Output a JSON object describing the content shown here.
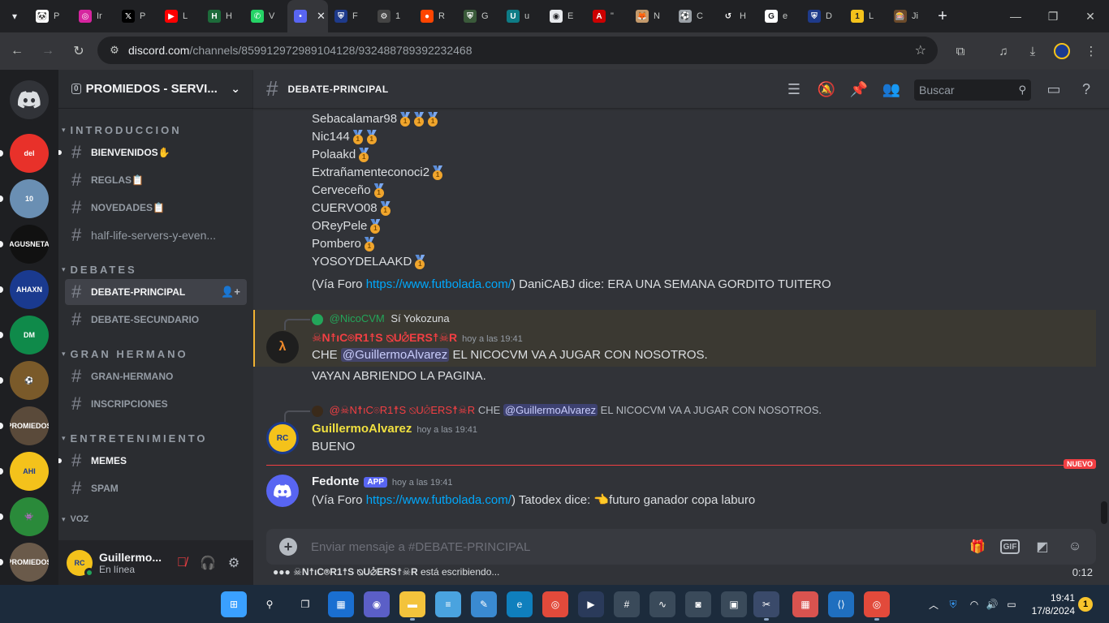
{
  "browser": {
    "tabs": [
      {
        "title": "P",
        "color": "#ffffff",
        "text": "🐼"
      },
      {
        "title": "Ir",
        "color": "#d6249f",
        "text": "◎"
      },
      {
        "title": "P",
        "color": "#000000",
        "text": "𝕏"
      },
      {
        "title": "L",
        "color": "#ff0000",
        "text": "▶"
      },
      {
        "title": "H",
        "color": "#1d6b3a",
        "text": "H"
      },
      {
        "title": "V",
        "color": "#25d366",
        "text": "✆"
      },
      {
        "title": "",
        "color": "#5865f2",
        "text": "•",
        "active": true
      },
      {
        "title": "F",
        "color": "#1e3a8a",
        "text": "⛨"
      },
      {
        "title": "1",
        "color": "#444444",
        "text": "⚙"
      },
      {
        "title": "R",
        "color": "#ff4500",
        "text": "●"
      },
      {
        "title": "G",
        "color": "#3a5a3a",
        "text": "⛨"
      },
      {
        "title": "u",
        "color": "#0e7c86",
        "text": "U"
      },
      {
        "title": "E",
        "color": "#e8eaed",
        "text": "◉"
      },
      {
        "title": "\"",
        "color": "#cc0000",
        "text": "A"
      },
      {
        "title": "N",
        "color": "#c49a6c",
        "text": "🦊"
      },
      {
        "title": "C",
        "color": "#9aa0a6",
        "text": "⚽"
      },
      {
        "title": "H",
        "color": "#202124",
        "text": "↺"
      },
      {
        "title": "e",
        "color": "#ffffff",
        "text": "G"
      },
      {
        "title": "D",
        "color": "#1e3a8a",
        "text": "⛨"
      },
      {
        "title": "L",
        "color": "#f4c21b",
        "text": "1"
      },
      {
        "title": "Ji",
        "color": "#6b4a2a",
        "text": "🎰"
      }
    ],
    "url_host": "discord.com",
    "url_path": "/channels/859912972989104128/932488789392232468",
    "icons": [
      "tune-icon",
      "star-icon",
      "extensions-icon",
      "media-icon",
      "download-icon",
      "profile-icon",
      "menu-icon"
    ]
  },
  "servers": [
    {
      "name": "del-server",
      "label": "del",
      "color": "#e8312a"
    },
    {
      "name": "maradona-server",
      "label": "10",
      "color": "#6a8fb3"
    },
    {
      "name": "la-agusneta-server",
      "label": "AGUSNETA",
      "color": "#111111"
    },
    {
      "name": "ahaxn-server",
      "label": "AHAXN",
      "color": "#1a3a8f"
    },
    {
      "name": "dm-server",
      "label": "DM",
      "color": "#0f8a4a"
    },
    {
      "name": "player-server",
      "label": "⚽",
      "color": "#7a5a2a"
    },
    {
      "name": "promiedos-server",
      "label": "PROMIEDOS",
      "color": "#5a4a3a"
    },
    {
      "name": "ahi-server",
      "label": "AHI",
      "color": "#f4c21b"
    },
    {
      "name": "monster-server",
      "label": "👾",
      "color": "#2a8a3a"
    },
    {
      "name": "promiedos2-server",
      "label": "PROMIEDOS",
      "color": "#6a5a4a"
    }
  ],
  "sidebar": {
    "server_name": "PROMIEDOS - SERVI...",
    "badge": "0",
    "categories": [
      {
        "name": "INTRODUCCION",
        "channels": [
          {
            "name": "BIENVENIDOS✋",
            "unread": true
          },
          {
            "name": "REGLAS📋",
            "unread": false
          },
          {
            "name": "NOVEDADES📋",
            "unread": false
          },
          {
            "name": "half-life-servers-y-even...",
            "unread": false,
            "plain": true
          }
        ]
      },
      {
        "name": "DEBATES",
        "channels": [
          {
            "name": "DEBATE-PRINCIPAL",
            "selected": true
          },
          {
            "name": "DEBATE-SECUNDARIO"
          }
        ]
      },
      {
        "name": "GRAN  HERMANO",
        "channels": [
          {
            "name": "GRAN-HERMANO"
          },
          {
            "name": "INSCRIPCIONES"
          }
        ]
      },
      {
        "name": "ENTRETENIMIENTO",
        "channels": [
          {
            "name": "MEMES",
            "unread": true
          },
          {
            "name": "SPAM"
          }
        ]
      }
    ],
    "voz_label": "VOZ"
  },
  "user": {
    "name": "Guillermo...",
    "status": "En línea"
  },
  "channel": {
    "name": "DEBATE-PRINCIPAL",
    "search_placeholder": "Buscar"
  },
  "medal_list": [
    {
      "name": "Sebacalamar98",
      "medals": 3
    },
    {
      "name": "Nic144",
      "medals": 2
    },
    {
      "name": "Polaakd",
      "medals": 1
    },
    {
      "name": "Extrañamenteconoci2",
      "medals": 1
    },
    {
      "name": "Cerveceño",
      "medals": 1
    },
    {
      "name": "CUERVO08",
      "medals": 1
    },
    {
      "name": "OReyPele",
      "medals": 1
    },
    {
      "name": "Pombero",
      "medals": 1
    },
    {
      "name": "YOSOYDELAAKD",
      "medals": 1
    }
  ],
  "foro_msg_1": {
    "prefix": "(Vía Foro ",
    "link": "https://www.futbolada.com/",
    "suffix": ") DaniCABJ dice: ERA UNA SEMANA GORDITO TUITERO"
  },
  "msg_nicotros": {
    "reply_user": "@NicoCVM",
    "reply_text": "Sí Yokozuna",
    "author": "☠N☨ıC⌾R1☨S ⦰U⦲ERS☨☠R",
    "time": "hoy a las 19:41",
    "line1_pre": "CHE ",
    "mention": "@GuillermoAlvarez",
    "line1_post": " EL NICOCVM VA A JUGAR CON NOSOTROS.",
    "line2": "VAYAN ABRIENDO LA PAGINA."
  },
  "msg_guillermo": {
    "reply_user": "@☠N☨ıC⌾R1☨S ⦰U⦲ERS☨☠R",
    "reply_pre": "CHE ",
    "reply_mention": "@GuillermoAlvarez",
    "reply_post": " EL NICOCVM VA A JUGAR CON NOSOTROS.",
    "author": "GuillermoAlvarez",
    "time": "hoy a las 19:41",
    "text": "BUENO"
  },
  "new_label": "NUEVO",
  "msg_fedonte": {
    "author": "Fedonte",
    "badge": "APP",
    "time": "hoy a las 19:41",
    "prefix": "(Vía Foro ",
    "link": "https://www.futbolada.com/",
    "suffix": ") Tatodex dice: 👈futuro ganador copa laburo"
  },
  "composer": {
    "placeholder": "Enviar mensaje a #DEBATE-PRINCIPAL"
  },
  "typing": {
    "dots": "●●●",
    "user": "☠N☨ıC⌾R1☨S ⦰U⦲ERS☨☠R",
    "text": " está escribiendo..."
  },
  "timer": "0:12",
  "taskbar": {
    "time": "19:41",
    "date": "17/8/2024",
    "notifications": "1"
  },
  "colors": {
    "accent": "#5865f2",
    "nico_name": "#f23f43",
    "guillermo_name": "#f0e040",
    "fedonte_name": "#f2f3f5"
  }
}
